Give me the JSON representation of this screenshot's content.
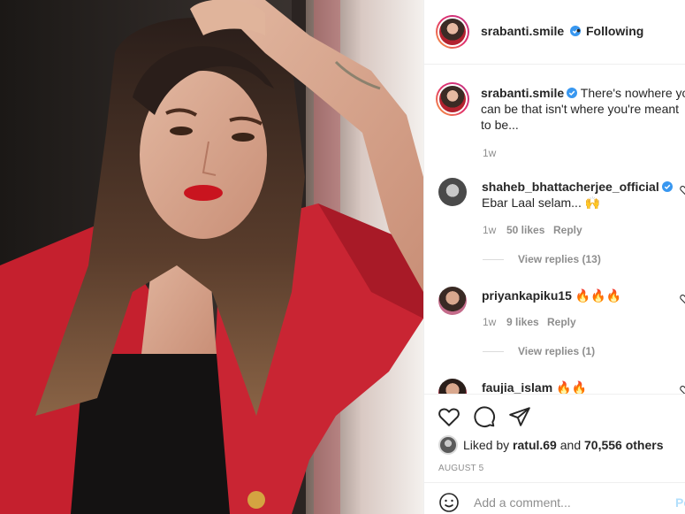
{
  "post": {
    "username": "srabanti.smile",
    "separator": "•",
    "follow_status": "Following",
    "caption_username": "srabanti.smile",
    "caption_text_line1": "There's nowhere you",
    "caption_text_line2": "can be that isn't where you're meant",
    "caption_text_line3": "to be...",
    "caption_time": "1w"
  },
  "comments": [
    {
      "username": "shaheb_bhattacherjee_official",
      "text": "Ebar Laal selam... 🙌",
      "time": "1w",
      "likes": "50 likes",
      "reply": "Reply",
      "view_replies": "View replies (13)"
    },
    {
      "username": "priyankapiku15",
      "text": "🔥🔥🔥",
      "time": "1w",
      "likes": "9 likes",
      "reply": "Reply",
      "view_replies": "View replies (1)"
    },
    {
      "username": "faujia_islam",
      "text": "🔥🔥"
    }
  ],
  "likes": {
    "prefix": "Liked by ",
    "user": "ratul.69",
    "middle": " and ",
    "count": "70,556 others"
  },
  "date": "AUGUST 5",
  "add_comment": {
    "placeholder": "Add a comment...",
    "post_label": "Post"
  },
  "icons": [
    "heart-icon",
    "comment-icon",
    "share-icon",
    "smiley-icon",
    "verified-badge-icon"
  ],
  "colors": {
    "verified": "#3897f0",
    "muted": "#8e8e8e",
    "text": "#262626"
  }
}
